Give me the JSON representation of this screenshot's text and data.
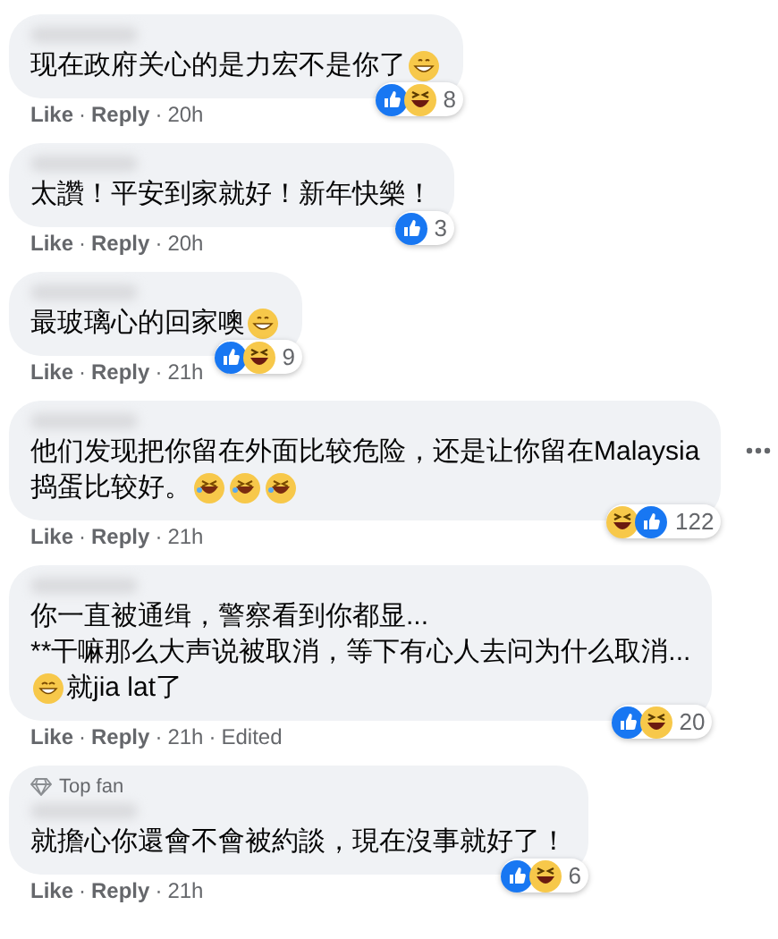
{
  "separator": "·",
  "comments": [
    {
      "top_fan": false,
      "more": false,
      "lines": [
        [
          {
            "kind": "text",
            "text": "现在政府关心的是力宏不是你了"
          },
          {
            "kind": "grin"
          }
        ]
      ],
      "reactions": [
        {
          "kind": "like"
        },
        {
          "kind": "haha"
        }
      ],
      "count": "8",
      "actions": [
        "Like",
        "Reply",
        "20h"
      ]
    },
    {
      "top_fan": false,
      "more": false,
      "lines": [
        [
          {
            "kind": "text",
            "text": "太讚！平安到家就好！新年快樂！"
          }
        ]
      ],
      "reactions": [
        {
          "kind": "like"
        }
      ],
      "count": "3",
      "actions": [
        "Like",
        "Reply",
        "20h"
      ]
    },
    {
      "top_fan": false,
      "more": false,
      "lines": [
        [
          {
            "kind": "text",
            "text": "最玻璃心的回家噢"
          },
          {
            "kind": "grin"
          }
        ]
      ],
      "reactions": [
        {
          "kind": "like"
        },
        {
          "kind": "haha"
        }
      ],
      "count": "9",
      "actions": [
        "Like",
        "Reply",
        "21h"
      ]
    },
    {
      "top_fan": false,
      "more": true,
      "lines": [
        [
          {
            "kind": "text",
            "text": "他们发现把你留在外面比较危险，还是让你留在Malaysia"
          }
        ],
        [
          {
            "kind": "text",
            "text": "捣蛋比较好。"
          },
          {
            "kind": "rofl"
          },
          {
            "kind": "rofl"
          },
          {
            "kind": "rofl"
          }
        ]
      ],
      "reactions": [
        {
          "kind": "haha"
        },
        {
          "kind": "like"
        }
      ],
      "count": "122",
      "actions": [
        "Like",
        "Reply",
        "21h"
      ]
    },
    {
      "top_fan": false,
      "more": false,
      "lines": [
        [
          {
            "kind": "text",
            "text": "你一直被通缉，警察看到你都显..."
          }
        ],
        [
          {
            "kind": "text",
            "text": "**干嘛那么大声说被取消，等下有心人去问为什么取消..."
          }
        ],
        [
          {
            "kind": "smile"
          },
          {
            "kind": "text",
            "text": "就jia lat了"
          }
        ]
      ],
      "reactions": [
        {
          "kind": "like"
        },
        {
          "kind": "haha"
        }
      ],
      "count": "20",
      "actions": [
        "Like",
        "Reply",
        "21h",
        "Edited"
      ]
    },
    {
      "top_fan": true,
      "badge": "Top fan",
      "more": false,
      "lines": [
        [
          {
            "kind": "text",
            "text": "就擔心你還會不會被約談，現在沒事就好了！"
          }
        ]
      ],
      "reactions": [
        {
          "kind": "like"
        },
        {
          "kind": "haha"
        }
      ],
      "count": "6",
      "actions": [
        "Like",
        "Reply",
        "21h"
      ]
    }
  ]
}
